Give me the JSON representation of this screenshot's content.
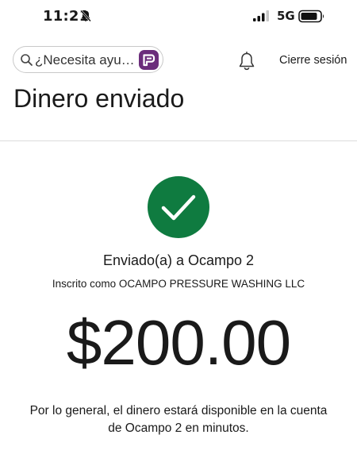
{
  "status_bar": {
    "time": "11:21",
    "network": "5G"
  },
  "header": {
    "search_placeholder": "¿Necesita ayu…",
    "logout_label": "Cierre sesión"
  },
  "page": {
    "title": "Dinero enviado"
  },
  "confirmation": {
    "recipient_line": "Enviado(a) a Ocampo 2",
    "registered_line": "Inscrito como OCAMPO PRESSURE WASHING LLC",
    "amount": "$200.00",
    "availability_line1": "Por lo general, el dinero estará disponible en la cuenta",
    "availability_line2": "de Ocampo 2 en minutos."
  },
  "colors": {
    "success": "#0f7b40",
    "assistant_badge": "#6b2d7b"
  }
}
